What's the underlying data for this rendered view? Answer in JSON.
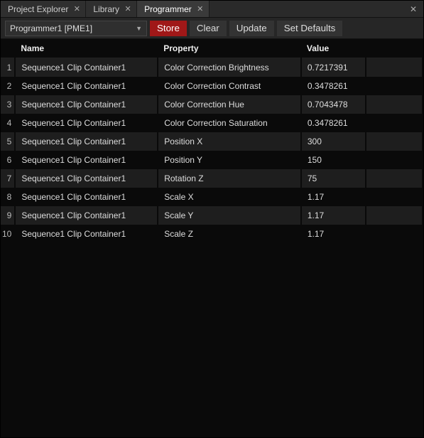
{
  "tabs": [
    {
      "label": "Project Explorer",
      "active": false
    },
    {
      "label": "Library",
      "active": false
    },
    {
      "label": "Programmer",
      "active": true
    }
  ],
  "toolbar": {
    "dropdown_value": "Programmer1 [PME1]",
    "store_label": "Store",
    "clear_label": "Clear",
    "update_label": "Update",
    "set_defaults_label": "Set Defaults"
  },
  "columns": {
    "name": "Name",
    "property": "Property",
    "value": "Value"
  },
  "rows": [
    {
      "num": "1",
      "name": "Sequence1 Clip Container1",
      "property": "Color Correction Brightness",
      "value": "0.7217391"
    },
    {
      "num": "2",
      "name": "Sequence1 Clip Container1",
      "property": "Color Correction Contrast",
      "value": "0.3478261"
    },
    {
      "num": "3",
      "name": "Sequence1 Clip Container1",
      "property": "Color Correction Hue",
      "value": "0.7043478"
    },
    {
      "num": "4",
      "name": "Sequence1 Clip Container1",
      "property": "Color Correction Saturation",
      "value": "0.3478261"
    },
    {
      "num": "5",
      "name": "Sequence1 Clip Container1",
      "property": "Position X",
      "value": "300"
    },
    {
      "num": "6",
      "name": "Sequence1 Clip Container1",
      "property": "Position Y",
      "value": "150"
    },
    {
      "num": "7",
      "name": "Sequence1 Clip Container1",
      "property": "Rotation Z",
      "value": "75"
    },
    {
      "num": "8",
      "name": "Sequence1 Clip Container1",
      "property": "Scale X",
      "value": "1.17"
    },
    {
      "num": "9",
      "name": "Sequence1 Clip Container1",
      "property": "Scale Y",
      "value": "1.17"
    },
    {
      "num": "10",
      "name": "Sequence1 Clip Container1",
      "property": "Scale Z",
      "value": "1.17"
    }
  ]
}
